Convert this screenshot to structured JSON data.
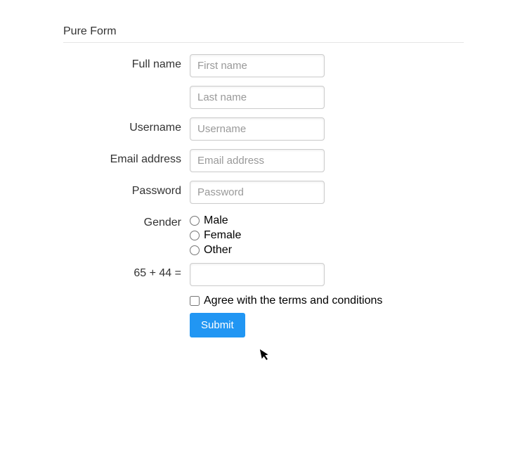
{
  "form": {
    "title": "Pure Form",
    "fields": {
      "fullname": {
        "label": "Full name",
        "first_placeholder": "First name",
        "last_placeholder": "Last name",
        "first_value": "",
        "last_value": ""
      },
      "username": {
        "label": "Username",
        "placeholder": "Username",
        "value": ""
      },
      "email": {
        "label": "Email address",
        "placeholder": "Email address",
        "value": ""
      },
      "password": {
        "label": "Password",
        "placeholder": "Password",
        "value": ""
      },
      "gender": {
        "label": "Gender",
        "options": {
          "male": "Male",
          "female": "Female",
          "other": "Other"
        }
      },
      "captcha": {
        "label": "65 + 44 =",
        "value": ""
      },
      "terms": {
        "label": "Agree with the terms and conditions"
      }
    },
    "submit_label": "Submit"
  }
}
